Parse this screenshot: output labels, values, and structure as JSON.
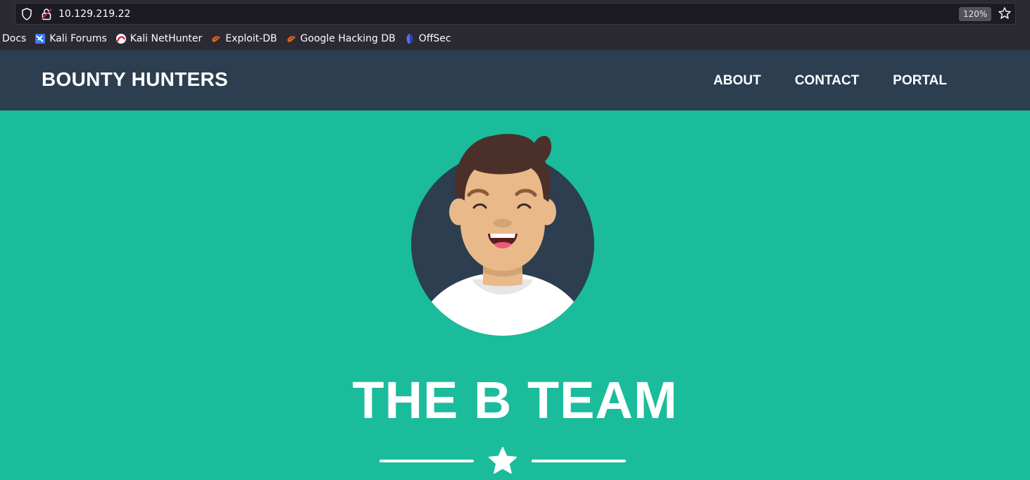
{
  "browser": {
    "url": "10.129.219.22",
    "zoom": "120%",
    "bookmarks": [
      {
        "label": "Docs",
        "icon": "none"
      },
      {
        "label": "Kali Forums",
        "icon": "kali-forums-icon"
      },
      {
        "label": "Kali NetHunter",
        "icon": "kali-nethunter-icon"
      },
      {
        "label": "Exploit-DB",
        "icon": "exploit-db-icon"
      },
      {
        "label": "Google Hacking DB",
        "icon": "ghdb-icon"
      },
      {
        "label": "OffSec",
        "icon": "offsec-icon"
      }
    ]
  },
  "site": {
    "brand": "BOUNTY HUNTERS",
    "nav": [
      {
        "label": "ABOUT"
      },
      {
        "label": "CONTACT"
      },
      {
        "label": "PORTAL"
      }
    ],
    "hero": {
      "title": "THE B TEAM"
    }
  },
  "colors": {
    "navbar": "#2c3e50",
    "hero_bg": "#1abc9c",
    "avatar_circle": "#2c3e50"
  }
}
